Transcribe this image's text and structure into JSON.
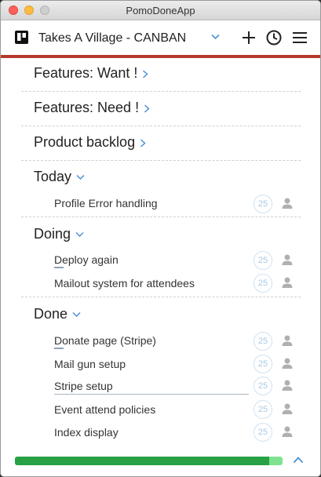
{
  "window": {
    "title": "PomoDoneApp"
  },
  "toolbar": {
    "board_title": "Takes A Village - CANBAN",
    "accent_color": "#b53a2a"
  },
  "groups": [
    {
      "label": "Features: Want !",
      "state": "collapsed"
    },
    {
      "label": "Features: Need !",
      "state": "collapsed"
    },
    {
      "label": "Product backlog",
      "state": "collapsed"
    },
    {
      "label": "Today",
      "state": "expanded",
      "tasks": [
        {
          "label": "Profile Error handling",
          "pomodoros": "25"
        }
      ]
    },
    {
      "label": "Doing",
      "state": "expanded",
      "tasks": [
        {
          "label": "Deploy again",
          "pomodoros": "25"
        },
        {
          "label": "Mailout system for attendees",
          "pomodoros": "25"
        }
      ]
    },
    {
      "label": "Done",
      "state": "expanded",
      "tasks": [
        {
          "label": "Donate page (Stripe)",
          "pomodoros": "25"
        },
        {
          "label": "Mail gun setup",
          "pomodoros": "25"
        },
        {
          "label": "Stripe setup",
          "pomodoros": "25"
        },
        {
          "label": "Event attend policies",
          "pomodoros": "25"
        },
        {
          "label": "Index display",
          "pomodoros": "25"
        }
      ]
    }
  ],
  "footer": {
    "progress_fraction": 0.95
  },
  "icons": {
    "board": "trello-board-icon",
    "add": "plus-icon",
    "history": "clock-icon",
    "menu": "hamburger-menu-icon",
    "collapsed": "chevron-right-icon",
    "expanded": "chevron-down-icon",
    "assign": "person-icon",
    "scroll": "chevron-up-icon"
  }
}
